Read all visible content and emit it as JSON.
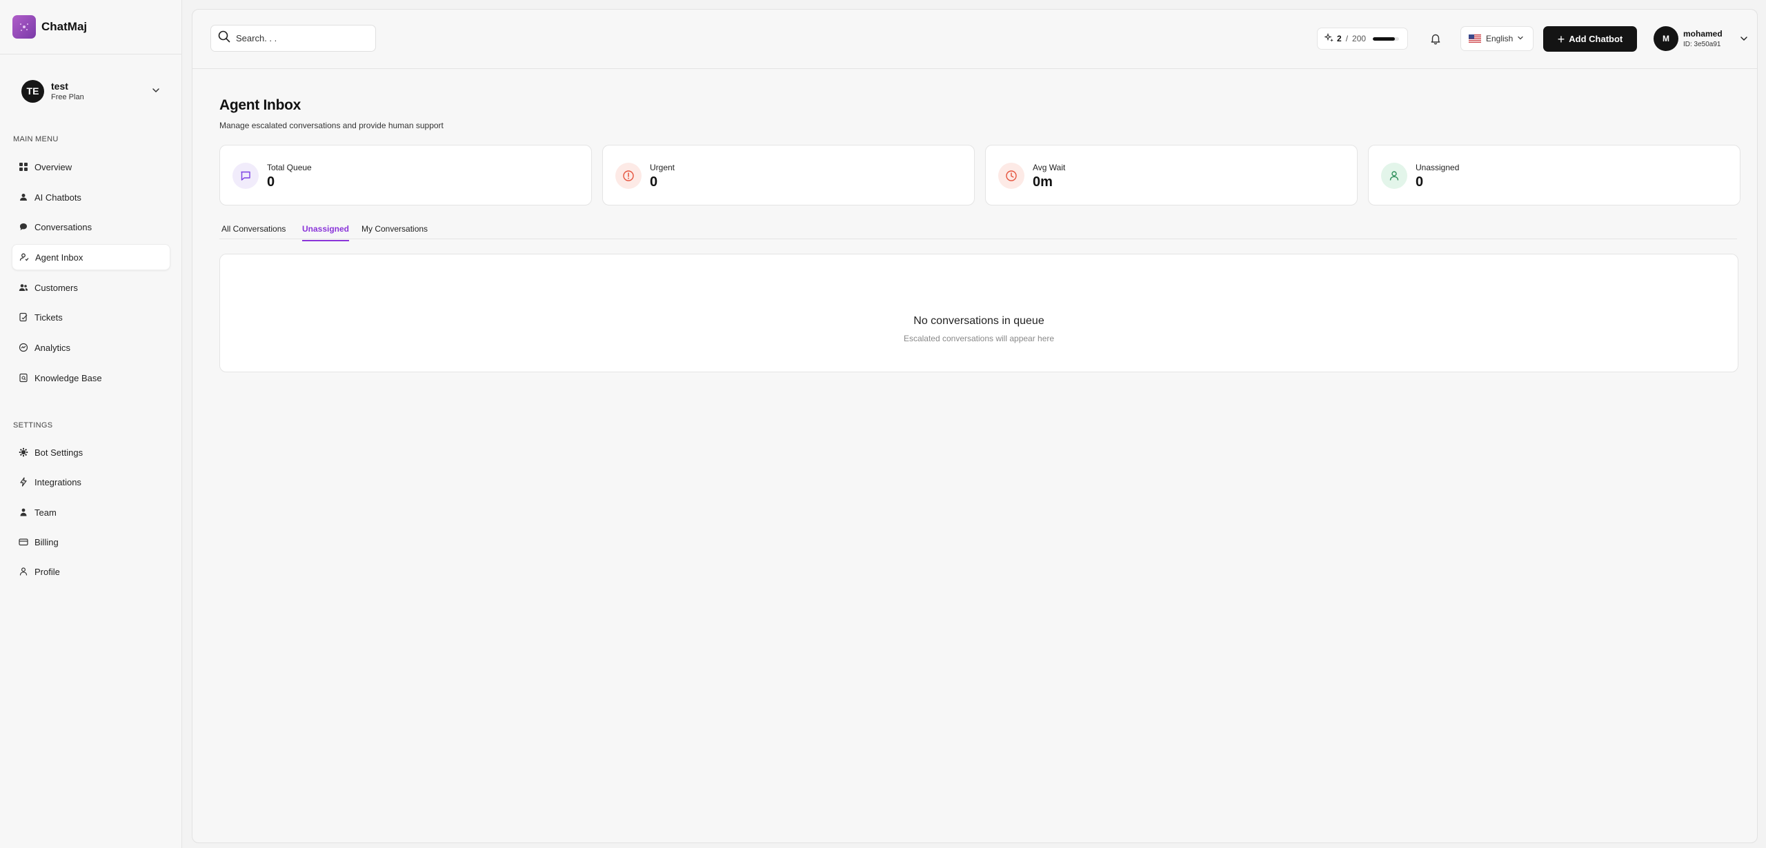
{
  "brand": {
    "name": "ChatMaj"
  },
  "workspace": {
    "initials": "TE",
    "name": "test",
    "plan": "Free Plan"
  },
  "sidebar": {
    "main_menu_label": "MAIN MENU",
    "main_items": [
      {
        "label": "Overview",
        "icon": "grid-icon"
      },
      {
        "label": "AI Chatbots",
        "icon": "user-icon"
      },
      {
        "label": "Conversations",
        "icon": "chat-bubble-icon"
      },
      {
        "label": "Agent Inbox",
        "icon": "agent-icon",
        "active": true
      },
      {
        "label": "Customers",
        "icon": "users-icon"
      },
      {
        "label": "Tickets",
        "icon": "ticket-icon"
      },
      {
        "label": "Analytics",
        "icon": "analytics-icon"
      },
      {
        "label": "Knowledge Base",
        "icon": "book-icon"
      }
    ],
    "settings_label": "SETTINGS",
    "settings_items": [
      {
        "label": "Bot Settings",
        "icon": "gear-icon"
      },
      {
        "label": "Integrations",
        "icon": "bolt-icon"
      },
      {
        "label": "Team",
        "icon": "person-icon"
      },
      {
        "label": "Billing",
        "icon": "card-icon"
      },
      {
        "label": "Profile",
        "icon": "profile-icon"
      }
    ]
  },
  "header": {
    "search_placeholder": "Search. . .",
    "credits": {
      "used": "2",
      "total": "200",
      "progress": 0.85
    },
    "language": "English",
    "add_button": "Add Chatbot",
    "user": {
      "initial": "M",
      "name": "mohamed",
      "id": "ID: 3e50a91"
    }
  },
  "page": {
    "title": "Agent Inbox",
    "subtitle": "Manage escalated conversations and provide human support"
  },
  "stats": [
    {
      "label": "Total Queue",
      "value": "0",
      "icon": "message-square-icon",
      "color": "#7b3fe4",
      "bg": "#f1ecfb"
    },
    {
      "label": "Urgent",
      "value": "0",
      "icon": "alert-circle-icon",
      "color": "#e5533d",
      "bg": "#fdeae6"
    },
    {
      "label": "Avg Wait",
      "value": "0m",
      "icon": "clock-icon",
      "color": "#e5533d",
      "bg": "#fdeae6"
    },
    {
      "label": "Unassigned",
      "value": "0",
      "icon": "user-icon",
      "color": "#2f8f5b",
      "bg": "#e3f5ea"
    }
  ],
  "tabs": [
    {
      "label": "All Conversations"
    },
    {
      "label": "Unassigned",
      "active": true
    },
    {
      "label": "My Conversations"
    }
  ],
  "empty_state": {
    "title": "No conversations in queue",
    "subtitle": "Escalated conversations will appear here"
  },
  "colors": {
    "accent": "#8a35d9",
    "dark": "#141414"
  }
}
